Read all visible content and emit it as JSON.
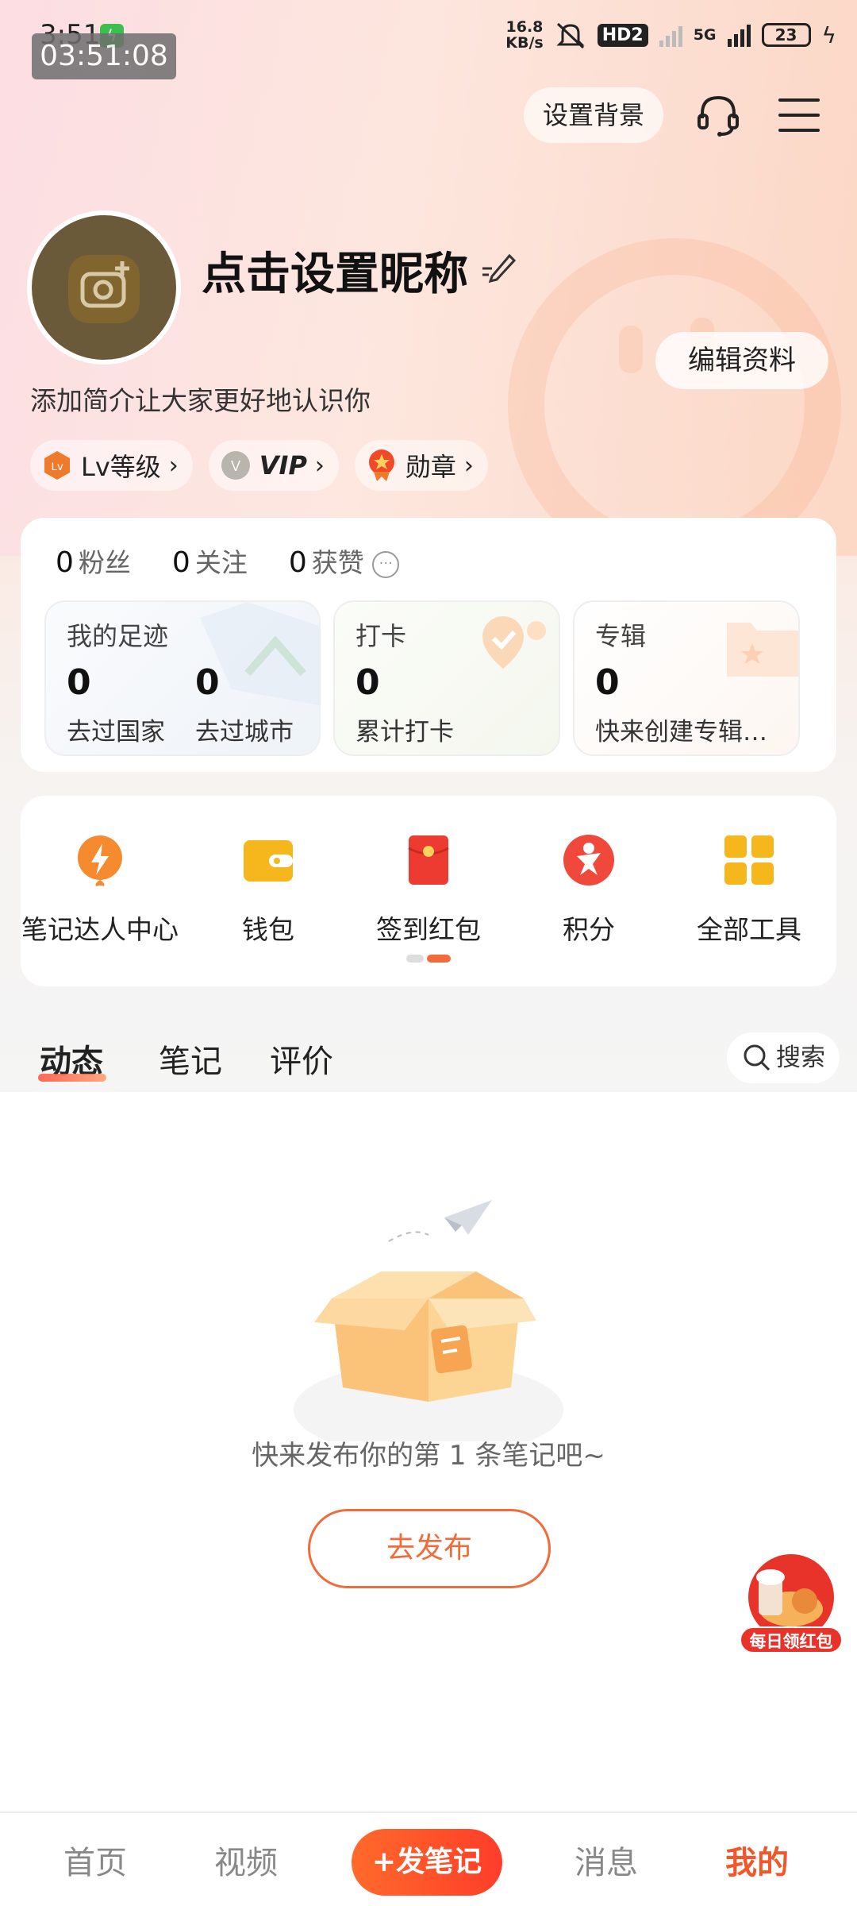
{
  "status_bar": {
    "time": "3:51",
    "time_overlay": "03:51:08",
    "net_speed_value": "16.8",
    "net_speed_unit": "KB/s",
    "hd_label": "HD2",
    "network_label": "5G",
    "battery": "23"
  },
  "header": {
    "set_background_label": "设置背景",
    "support_icon": "headset-icon",
    "menu_icon": "hamburger-menu-icon"
  },
  "profile": {
    "nickname": "点击设置昵称",
    "edit_profile_label": "编辑资料",
    "bio": "添加简介让大家更好地认识你",
    "badges": [
      {
        "label": "Lv等级",
        "icon": "lv-icon",
        "color": "#f07a2b"
      },
      {
        "label": "VIP",
        "icon": "vip-icon",
        "color": "#b9b4ae"
      },
      {
        "label": "勋章",
        "icon": "medal-icon",
        "color": "#f04a2b"
      }
    ]
  },
  "stats": {
    "followers_count": "0",
    "followers_label": "粉丝",
    "following_count": "0",
    "following_label": "关注",
    "likes_count": "0",
    "likes_label": "获赞"
  },
  "footprint": {
    "title": "我的足迹",
    "countries_count": "0",
    "countries_label": "去过国家",
    "cities_count": "0",
    "cities_label": "去过城市"
  },
  "checkin": {
    "title": "打卡",
    "count": "0",
    "label": "累计打卡"
  },
  "album": {
    "title": "专辑",
    "count": "0",
    "label": "快来创建专辑…"
  },
  "tools": [
    {
      "label": "笔记达人中心",
      "icon": "lightning-icon",
      "color": "#f58a2e"
    },
    {
      "label": "钱包",
      "icon": "wallet-icon",
      "color": "#f5b71b"
    },
    {
      "label": "签到红包",
      "icon": "red-envelope-icon",
      "color": "#ee3b32"
    },
    {
      "label": "积分",
      "icon": "points-icon",
      "color": "#f0493c"
    },
    {
      "label": "全部工具",
      "icon": "grid-icon",
      "color": "#f5b71b"
    }
  ],
  "tabs": {
    "items": [
      "动态",
      "笔记",
      "评价"
    ],
    "active": "动态",
    "search_label": "搜索"
  },
  "empty_state": {
    "message": "快来发布你的第 1 条笔记吧~",
    "button_label": "去发布"
  },
  "float_badge": {
    "label": "每日领红包"
  },
  "bottom_nav": {
    "home": "首页",
    "video": "视频",
    "post": "发笔记",
    "messages": "消息",
    "me": "我的",
    "active": "我的",
    "accent_color": "#f2562b"
  }
}
